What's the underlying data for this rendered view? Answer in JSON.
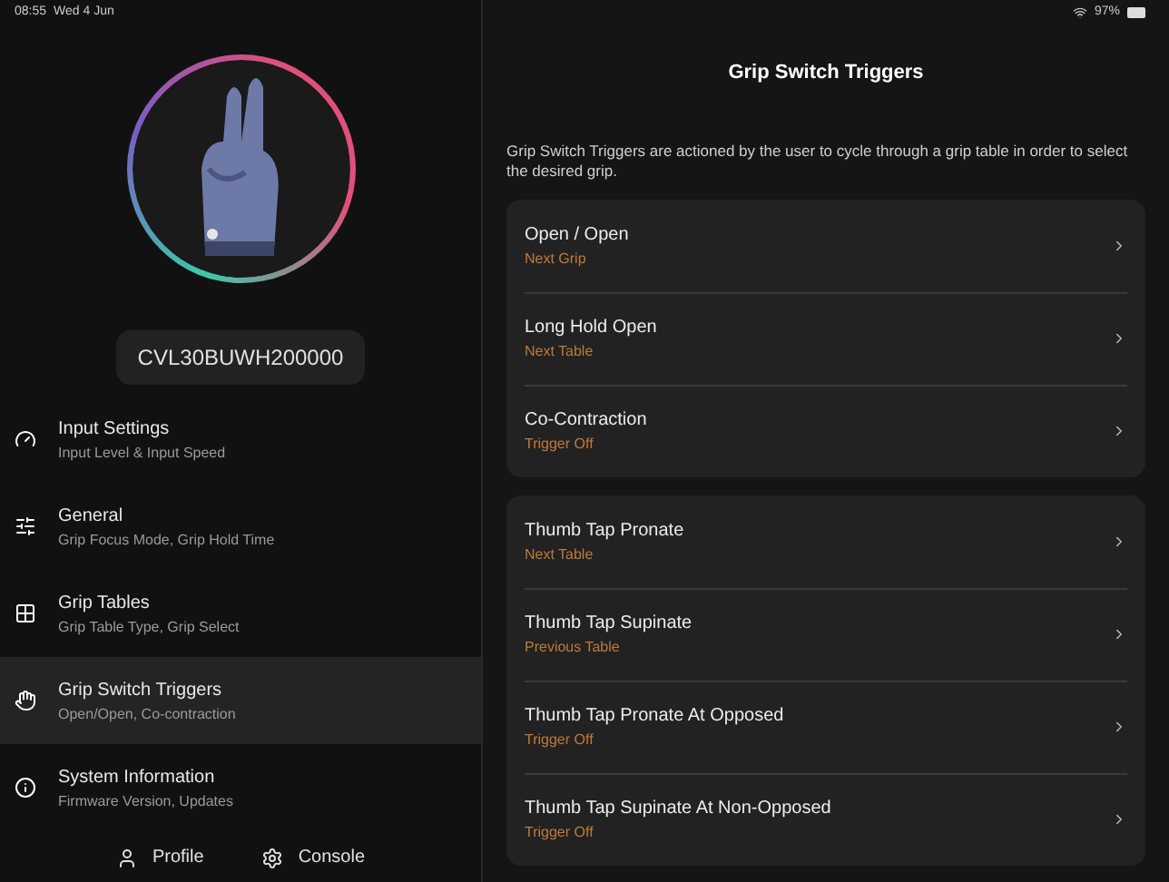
{
  "status_bar": {
    "time": "08:55",
    "date": "Wed 4 Jun",
    "battery": "97%"
  },
  "sidebar": {
    "serial": "CVL30BUWH200000",
    "items": [
      {
        "title": "Input Settings",
        "subtitle": "Input Level & Input Speed",
        "kind": "input",
        "selected": false
      },
      {
        "title": "General",
        "subtitle": "Grip Focus Mode, Grip Hold Time",
        "kind": "general",
        "selected": false
      },
      {
        "title": "Grip Tables",
        "subtitle": "Grip Table Type, Grip Select",
        "kind": "tables",
        "selected": false
      },
      {
        "title": "Grip Switch Triggers",
        "subtitle": "Open/Open, Co-contraction",
        "kind": "triggers",
        "selected": true
      },
      {
        "title": "System Information",
        "subtitle": "Firmware Version, Updates",
        "kind": "info",
        "selected": false
      }
    ],
    "footer": [
      {
        "label": "Profile",
        "kind": "profile"
      },
      {
        "label": "Console",
        "kind": "console"
      }
    ]
  },
  "main": {
    "title": "Grip Switch Triggers",
    "description": "Grip Switch Triggers are actioned by the user to cycle through a grip table in order to select the desired grip.",
    "groups": [
      [
        {
          "title": "Open / Open",
          "value": "Next Grip"
        },
        {
          "title": "Long Hold Open",
          "value": "Next Table"
        },
        {
          "title": "Co-Contraction",
          "value": "Trigger Off"
        }
      ],
      [
        {
          "title": "Thumb Tap Pronate",
          "value": "Next Table"
        },
        {
          "title": "Thumb Tap Supinate",
          "value": "Previous Table"
        },
        {
          "title": "Thumb Tap Pronate At Opposed",
          "value": "Trigger Off"
        },
        {
          "title": "Thumb Tap Supinate At Non-Opposed",
          "value": "Trigger Off"
        }
      ]
    ]
  }
}
